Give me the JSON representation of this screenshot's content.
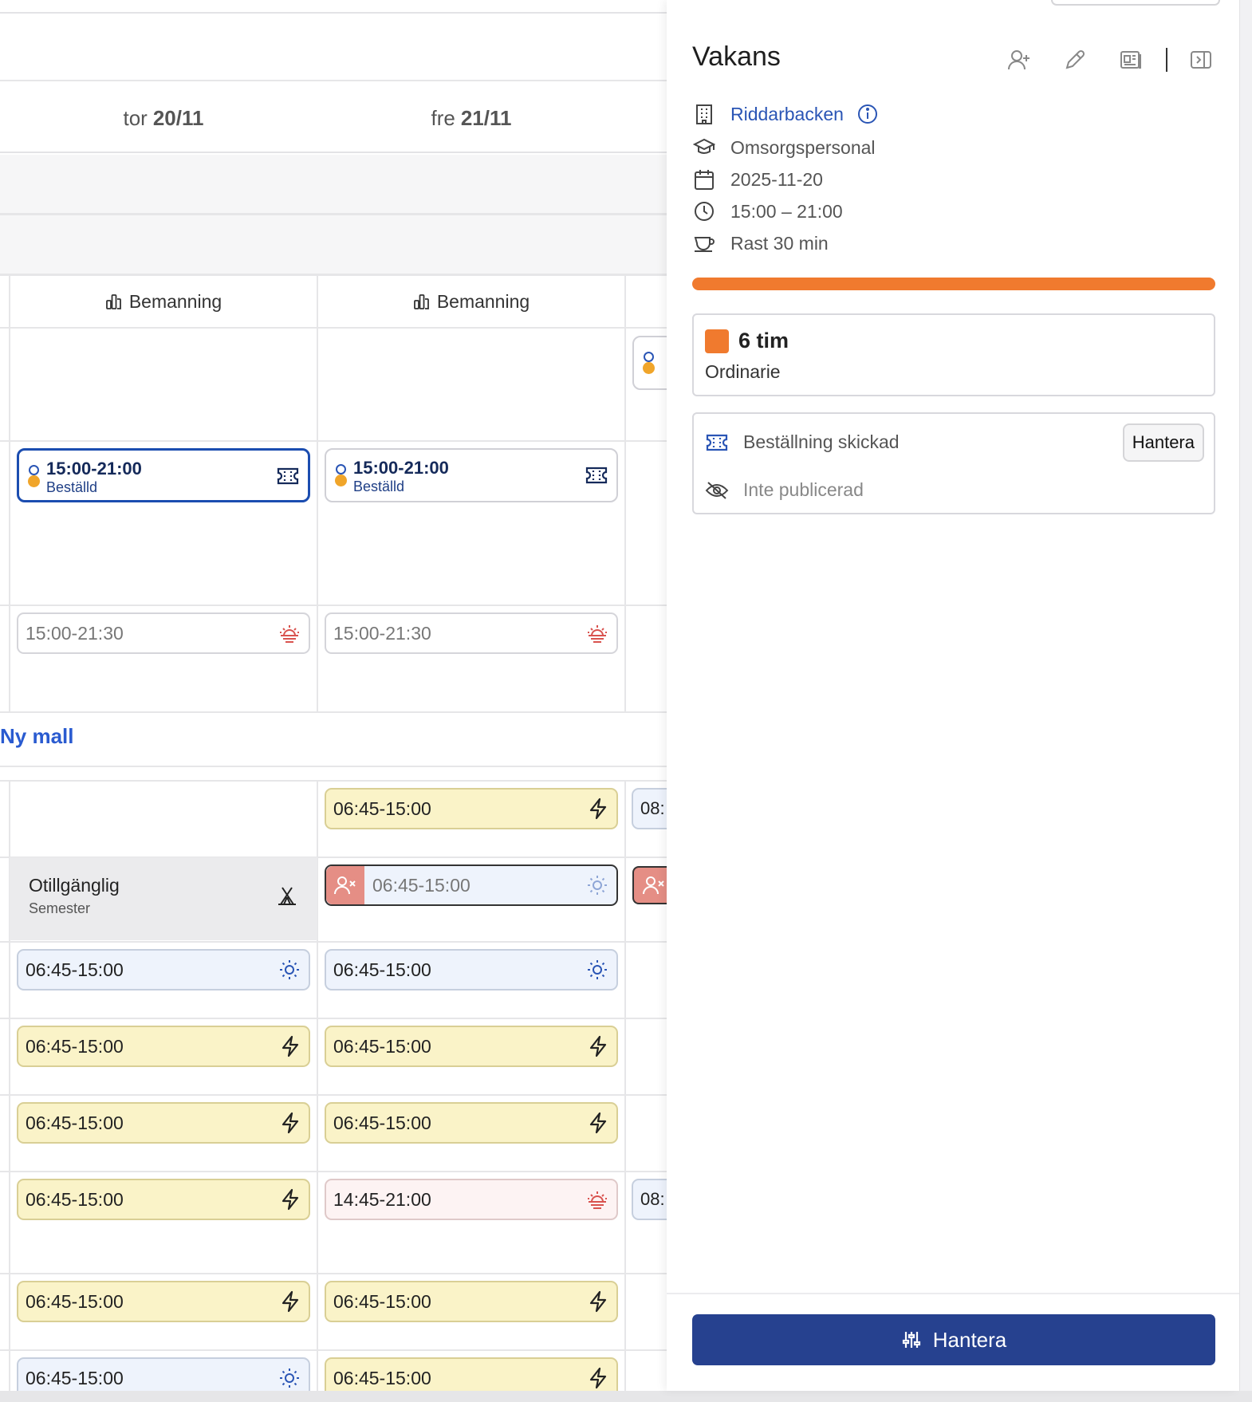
{
  "days": [
    {
      "weekday": "tor",
      "date": "20/11"
    },
    {
      "weekday": "fre",
      "date": "21/11"
    }
  ],
  "bemanning_label": "Bemanning",
  "orders": [
    {
      "time": "15:00-21:00",
      "status": "Beställd"
    },
    {
      "time": "15:00-21:00",
      "status": "Beställd"
    }
  ],
  "evening_shifts": [
    "15:00-21:30",
    "15:00-21:30"
  ],
  "new_template_label": "Ny mall",
  "unavailable": {
    "title": "Otillgänglig",
    "reason": "Semester"
  },
  "shifts": {
    "row1_fre": "06:45-15:00",
    "row1_cut": "08:",
    "row2_fre": "06:45-15:00",
    "row3": [
      "06:45-15:00",
      "06:45-15:00"
    ],
    "row4": [
      "06:45-15:00",
      "06:45-15:00"
    ],
    "row5": [
      "06:45-15:00",
      "06:45-15:00"
    ],
    "row6": [
      "06:45-15:00",
      "14:45-21:00"
    ],
    "row6_cut": "08:",
    "row7": [
      "06:45-15:00",
      "06:45-15:00"
    ],
    "row8": [
      "06:45-15:00",
      "06:45-15:00"
    ]
  },
  "panel": {
    "title": "Vakans",
    "unit": "Riddarbacken",
    "role": "Omsorgspersonal",
    "date": "2025-11-20",
    "time": "15:00 – 21:00",
    "break": "Rast 30 min",
    "hours": "6 tim",
    "hours_type": "Ordinarie",
    "order_status": "Beställning skickad",
    "publish_status": "Inte publicerad",
    "manage_small": "Hantera",
    "manage_button": "Hantera"
  },
  "colors": {
    "accent": "#26418f",
    "orange": "#f07a2e",
    "link": "#2a55b5",
    "yellow_shift": "#faf3c8",
    "blue_shift": "#eef3fc"
  }
}
